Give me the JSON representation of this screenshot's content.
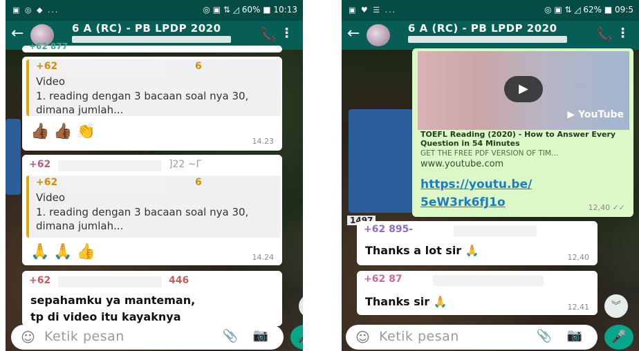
{
  "left": {
    "status": {
      "left": "▣ ◎ ◆ ...",
      "right": "◎ ▣ ⇅ ◿ 60% ■ 10:13"
    },
    "header": {
      "title": "6 A (RC) - PB LPDP 2020",
      "back_icon": "←",
      "call_icon": "📞",
      "menu_icon": "⋮"
    },
    "top_partial": "+62 877",
    "messages": [
      {
        "sender": "+62",
        "sender_tail": "6",
        "quote_type": "Video",
        "quote_text": "1. reading dengan 3 bacaan soal nya 30, dimana jumlah...",
        "emoji": "👍🏾👍🏾👏",
        "time": "14.23"
      },
      {
        "sender": "+62",
        "sender_mid": "]22 ~Γ",
        "quote_sender": "+62",
        "quote_sender_tail": "6",
        "quote_type": "Video",
        "quote_text": "1. reading dengan 3 bacaan soal nya 30, dimana jumlah...",
        "emoji": "🙏🙏👍",
        "time": "14.24"
      },
      {
        "sender": "+62",
        "sender_mid": "446",
        "text_l1": "sepahamku ya manteman,",
        "text_l2": "tp di video itu kayaknya"
      }
    ],
    "input": {
      "placeholder": "Ketik pesan",
      "smile_icon": "☺",
      "clip_icon": "📎",
      "camera_icon": "📷",
      "mic_icon": "🎤"
    },
    "scroll_icon": "︾"
  },
  "right": {
    "status": {
      "left": "▣ ♥ ☰ ...",
      "right": "◎ ▣ ⇅ ◿ 62% ■ 09:5"
    },
    "header": {
      "title": "6 A (RC) - PB LPDP 2020",
      "back_icon": "←",
      "call_icon": "📞",
      "menu_icon": "⋮"
    },
    "link_preview": {
      "title": "TOEFL Reading (2020) - How to Answer Every Question in 54 Minutes",
      "desc": "GET THE FREE PDF VERSION OF TIM...",
      "domain": "www.youtube.com",
      "yt_logo": "▶ YouTube",
      "play_icon": "▶",
      "url_l1": "https://youtu.be/",
      "url_l2": "5eW3rk6fJ1o",
      "time": "12,40 ✓✓"
    },
    "plate": "1497",
    "messages": [
      {
        "sender": "+62 895-",
        "text": "Thanks a lot sir 🙏",
        "time": "12,40"
      },
      {
        "sender": "+62 87",
        "text": "Thanks sir 🙏",
        "time": "12,41"
      }
    ],
    "input": {
      "placeholder": "Ketik pesan",
      "smile_icon": "☺",
      "clip_icon": "📎",
      "camera_icon": "📷",
      "mic_icon": "🎤"
    },
    "scroll_icon": "︾"
  },
  "colors": {
    "header": "#075e54",
    "status": "#054d44",
    "outgoing": "#dcf8c6",
    "link": "#1a7cc4",
    "quote_bar": "#e0a800"
  }
}
